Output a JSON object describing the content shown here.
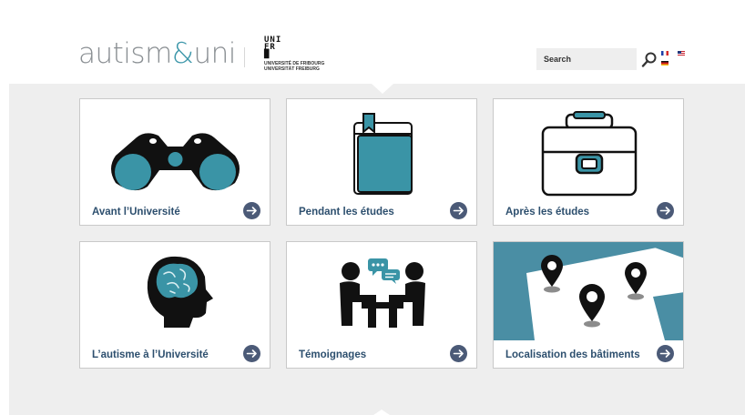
{
  "header": {
    "logo_prefix": "autism",
    "logo_amp": "&",
    "logo_suffix": "uni",
    "unifr_mark": "UNI\nFR\n█",
    "unifr_caption_1": "UNIVERSITÉ DE FRIBOURG",
    "unifr_caption_2": "UNIVERSITÄT FREIBURG",
    "search_label": "Search",
    "languages": [
      "fr",
      "en",
      "de"
    ]
  },
  "tiles": [
    {
      "label": "Avant l’Université",
      "icon": "binoculars-icon"
    },
    {
      "label": "Pendant les études",
      "icon": "book-icon"
    },
    {
      "label": "Après les études",
      "icon": "briefcase-icon"
    },
    {
      "label": "L’autisme à l’Université",
      "icon": "brain-head-icon"
    },
    {
      "label": "Témoignages",
      "icon": "conversation-icon"
    },
    {
      "label": "Localisation des bâtiments",
      "icon": "map-pins-icon"
    }
  ],
  "colors": {
    "accent": "#3d97aa",
    "label": "#2d4f6e",
    "arrow": "#4b5a77",
    "panel": "#eeeeee",
    "map_bg": "#4a8ea4"
  }
}
